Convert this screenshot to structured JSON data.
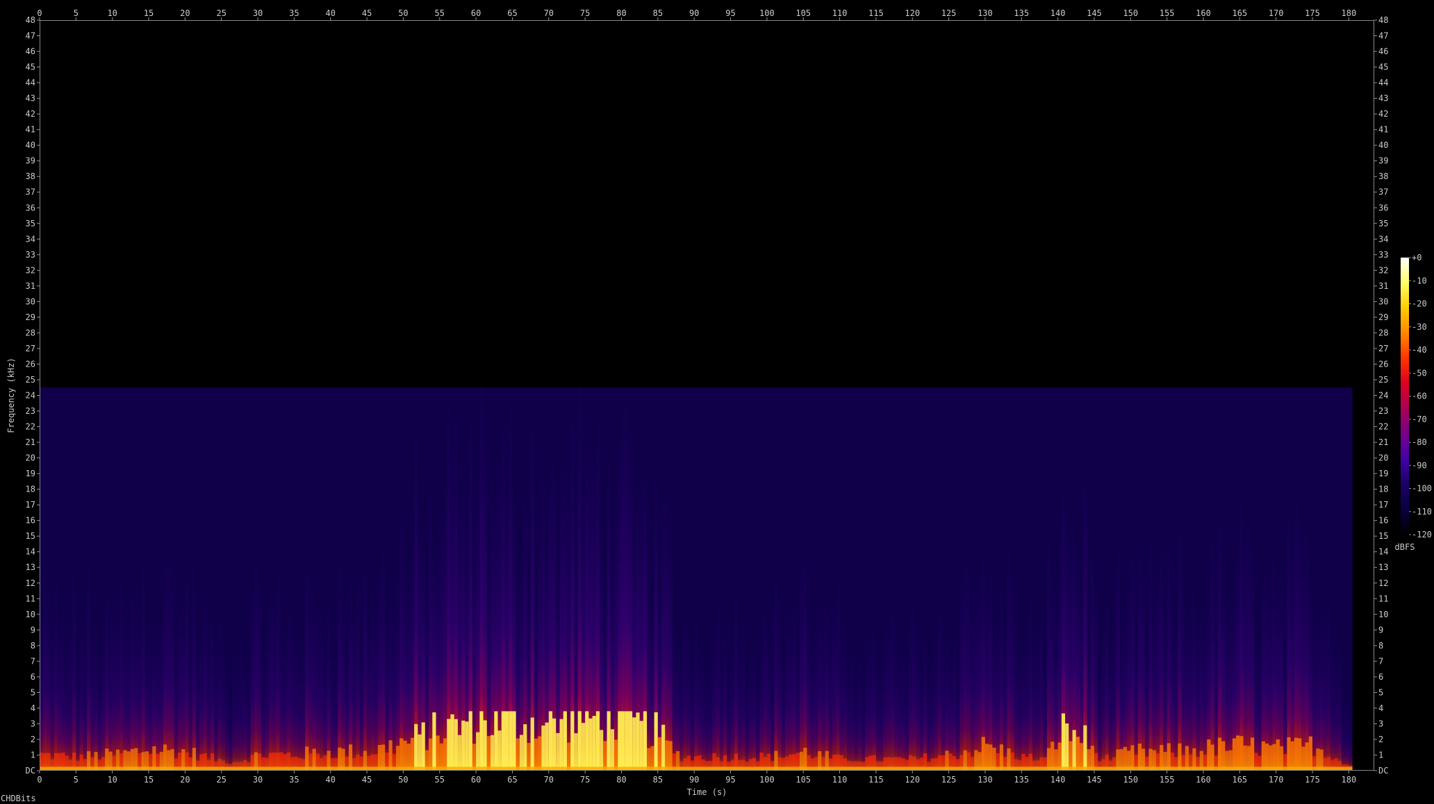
{
  "footer_label": "CHDBits",
  "chart_data": {
    "type": "heatmap",
    "kind": "spectrogram",
    "xlabel": "Time (s)",
    "ylabel": "Frequency (kHz)",
    "xlim": [
      0,
      183.5
    ],
    "ylim": [
      0,
      48
    ],
    "x_ticks": [
      0,
      5,
      10,
      15,
      20,
      25,
      30,
      35,
      40,
      45,
      50,
      55,
      60,
      65,
      70,
      75,
      80,
      85,
      90,
      95,
      100,
      105,
      110,
      115,
      120,
      125,
      130,
      135,
      140,
      145,
      150,
      155,
      160,
      165,
      170,
      175,
      180
    ],
    "y_ticks": [
      "DC",
      "1",
      "2",
      "3",
      "4",
      "5",
      "6",
      "7",
      "8",
      "9",
      "10",
      "11",
      "12",
      "13",
      "14",
      "15",
      "16",
      "17",
      "18",
      "19",
      "20",
      "21",
      "22",
      "23",
      "24",
      "25",
      "26",
      "27",
      "28",
      "29",
      "30",
      "31",
      "32",
      "33",
      "34",
      "35",
      "36",
      "37",
      "38",
      "39",
      "40",
      "41",
      "42",
      "43",
      "44",
      "45",
      "46",
      "47",
      "48"
    ],
    "ticks_on_all_sides": true,
    "bandlimit_khz": 24.5,
    "audio_end_s": 180.5,
    "colorbar": {
      "unit": "dBFS",
      "ticks": [
        "+0",
        "-10",
        "-20",
        "-30",
        "-40",
        "-50",
        "-60",
        "-70",
        "-80",
        "-90",
        "-100",
        "-110",
        "-120"
      ],
      "range": [
        -120,
        0
      ],
      "stops": [
        "#ffffff",
        "#ffff66",
        "#ffcc00",
        "#ff8800",
        "#ff3300",
        "#dd0022",
        "#aa0055",
        "#770088",
        "#4400aa",
        "#1a0066",
        "#0a0040",
        "#000000"
      ]
    },
    "energy_envelope": [
      {
        "t": 0,
        "level": 0.45
      },
      {
        "t": 5,
        "level": 0.4
      },
      {
        "t": 10,
        "level": 0.45
      },
      {
        "t": 15,
        "level": 0.55
      },
      {
        "t": 20,
        "level": 0.5
      },
      {
        "t": 24,
        "level": 0.35
      },
      {
        "t": 26,
        "level": 0.25
      },
      {
        "t": 30,
        "level": 0.45
      },
      {
        "t": 35,
        "level": 0.45
      },
      {
        "t": 40,
        "level": 0.5
      },
      {
        "t": 45,
        "level": 0.5
      },
      {
        "t": 50,
        "level": 0.65
      },
      {
        "t": 55,
        "level": 0.8
      },
      {
        "t": 60,
        "level": 0.9
      },
      {
        "t": 65,
        "level": 0.9
      },
      {
        "t": 70,
        "level": 0.85
      },
      {
        "t": 75,
        "level": 0.95
      },
      {
        "t": 80,
        "level": 0.9
      },
      {
        "t": 85,
        "level": 0.75
      },
      {
        "t": 88,
        "level": 0.4
      },
      {
        "t": 95,
        "level": 0.4
      },
      {
        "t": 100,
        "level": 0.4
      },
      {
        "t": 105,
        "level": 0.5
      },
      {
        "t": 110,
        "level": 0.35
      },
      {
        "t": 115,
        "level": 0.35
      },
      {
        "t": 120,
        "level": 0.35
      },
      {
        "t": 125,
        "level": 0.45
      },
      {
        "t": 130,
        "level": 0.6
      },
      {
        "t": 135,
        "level": 0.4
      },
      {
        "t": 138,
        "level": 0.35
      },
      {
        "t": 140,
        "level": 0.8
      },
      {
        "t": 143,
        "level": 0.75
      },
      {
        "t": 146,
        "level": 0.35
      },
      {
        "t": 150,
        "level": 0.5
      },
      {
        "t": 155,
        "level": 0.5
      },
      {
        "t": 160,
        "level": 0.55
      },
      {
        "t": 165,
        "level": 0.6
      },
      {
        "t": 170,
        "level": 0.55
      },
      {
        "t": 175,
        "level": 0.6
      },
      {
        "t": 178,
        "level": 0.4
      },
      {
        "t": 180,
        "level": 0.1
      }
    ]
  }
}
